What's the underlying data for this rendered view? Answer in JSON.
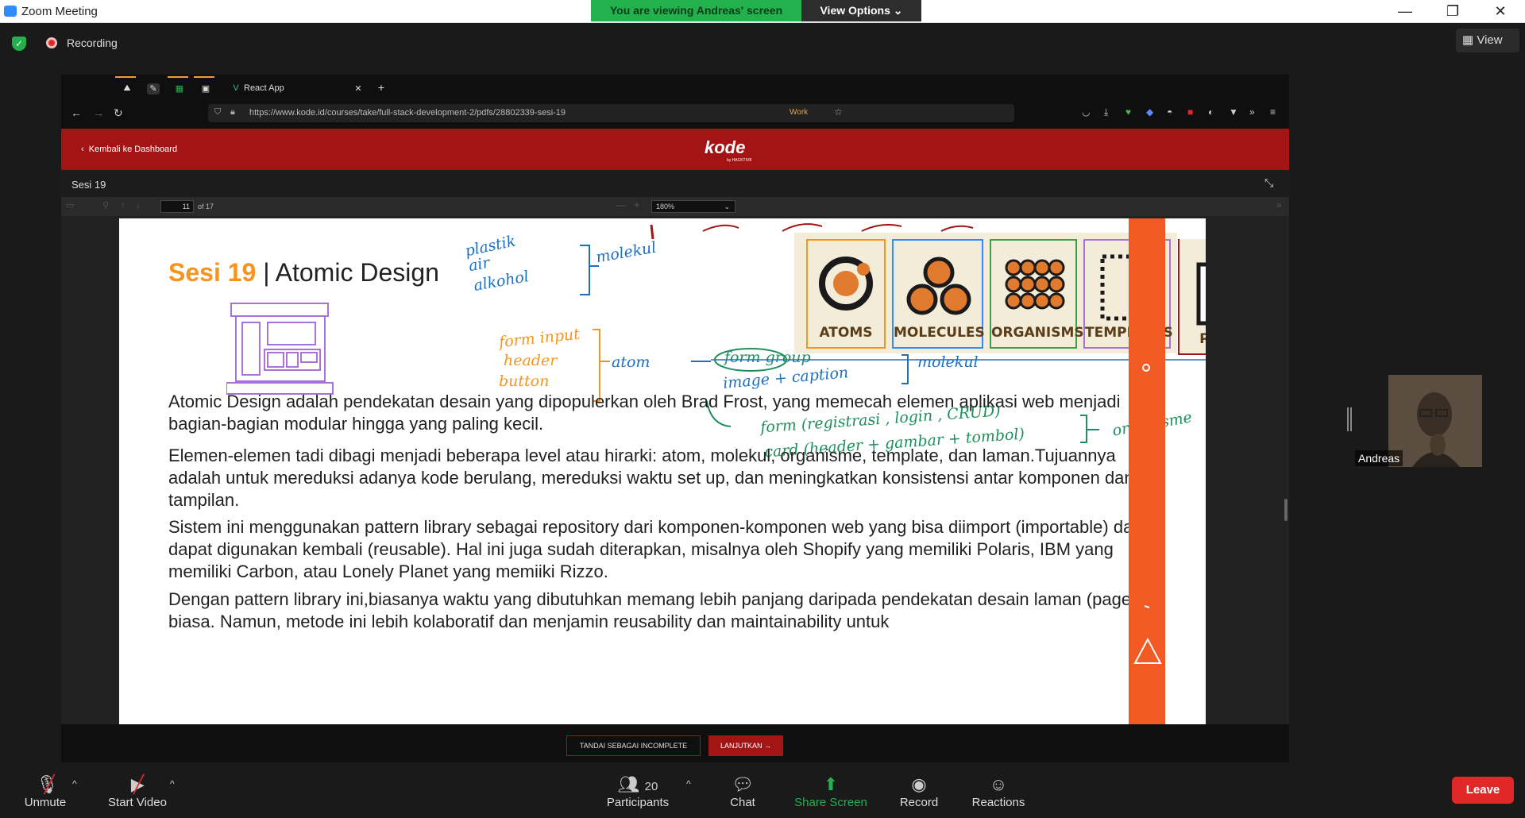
{
  "window": {
    "title": "Zoom Meeting",
    "viewing_banner": "You are viewing Andreas' screen",
    "view_options": "View Options"
  },
  "zoom": {
    "recording": "Recording",
    "view_button": "View"
  },
  "browser": {
    "tab_title": "React App",
    "url": "https://www.kode.id/courses/take/full-stack-development-2/pdfs/28802339-sesi-19",
    "work_label": "Work"
  },
  "kode": {
    "back_link": "Kembali ke Dashboard",
    "logo": "kode",
    "logo_sub": "by HACKTIV8"
  },
  "pdf": {
    "session_title": "Sesi 19",
    "page_current": "11",
    "page_of": "of 17",
    "zoom": "180%"
  },
  "slide": {
    "title_highlight": "Sesi 19",
    "title_rest": "| Atomic Design",
    "paragraphs": [
      "Atomic Design adalah pendekatan desain yang dipopulerkan oleh Brad Frost, yang memecah elemen aplikasi web menjadi bagian-bagian modular hingga yang paling kecil.",
      "Elemen-elemen tadi dibagi menjadi beberapa level atau hirarki: atom, molekul, organisme, template, dan laman.Tujuannya adalah untuk mereduksi adanya kode berulang, mereduksi waktu set up, dan meningkatkan konsistensi antar komponen dan tampilan.",
      "Sistem ini menggunakan pattern library sebagai repository dari komponen-komponen web yang bisa diimport (importable) dan dapat digunakan kembali (reusable). Hal ini juga sudah diterapkan, misalnya oleh Shopify yang memiliki Polaris, IBM yang memiliki Carbon, atau Lonely Planet yang memiiki Rizzo.",
      "Dengan pattern library ini,biasanya waktu yang dibutuhkan memang lebih panjang daripada pendekatan desain laman (pages) biasa. Namun, metode ini lebih kolaboratif dan menjamin reusability dan maintainability untuk"
    ],
    "atomic_labels": [
      "ATOMS",
      "MOLECULES",
      "ORGANISMS",
      "TEMPLATES",
      "PAGES"
    ],
    "annotations": {
      "plastik": "plastik",
      "air": "air",
      "alkohol": "alkohol",
      "molekul1": "molekul",
      "form_input": "form input",
      "header": "header",
      "button": "button",
      "atom": "atom",
      "form_group": "form group",
      "image_caption": "image + caption",
      "molekul2": "molekul",
      "form_reg": "form (registrasi , login , CRUD)",
      "card": "card (header + gambar + tombol)",
      "organisme": "organisme"
    }
  },
  "actions": {
    "incomplete": "TANDAI SEBAGAI INCOMPLETE",
    "continue": "LANJUTKAN →"
  },
  "participant": {
    "name": "Andreas"
  },
  "toolbar": {
    "unmute": "Unmute",
    "start_video": "Start Video",
    "participants": "Participants",
    "participants_count": "20",
    "chat": "Chat",
    "share_screen": "Share Screen",
    "record": "Record",
    "reactions": "Reactions",
    "leave": "Leave"
  },
  "colors": {
    "kode_red": "#a31515",
    "accent_orange": "#f7941d",
    "zoom_green": "#23b14d",
    "leave_red": "#e02828"
  }
}
